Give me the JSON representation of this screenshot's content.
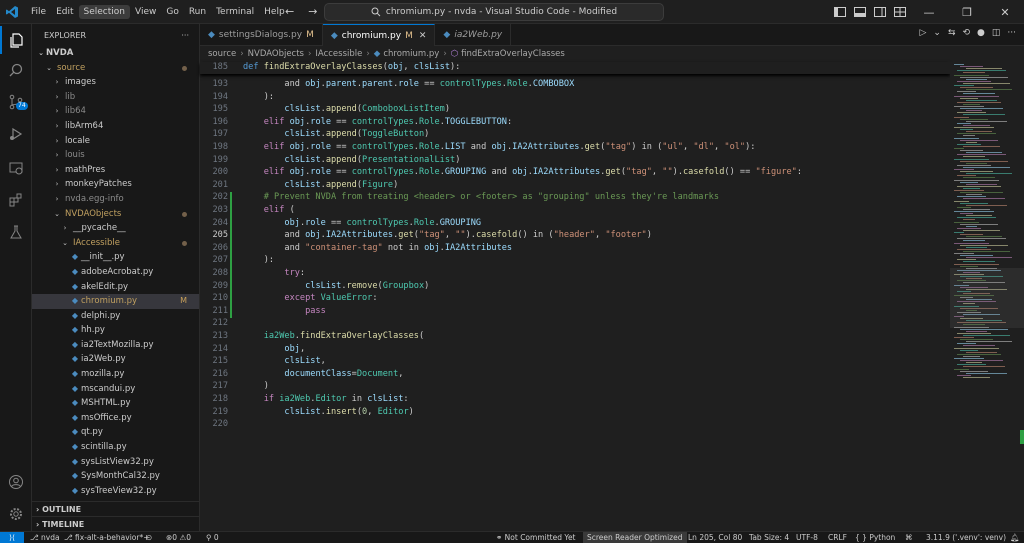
{
  "titlebar": {
    "menus": [
      "File",
      "Edit",
      "Selection",
      "View",
      "Go",
      "Run",
      "Terminal",
      "Help"
    ],
    "active_menu": "Selection",
    "command_center": "chromium.py - nvda - Visual Studio Code - Modified"
  },
  "activity": {
    "source_control_badge": "74"
  },
  "sidebar": {
    "title": "EXPLORER",
    "root": "NVDA",
    "items": [
      {
        "label": "source",
        "indent": 1,
        "type": "folder-open",
        "style": "yellow",
        "dot": true
      },
      {
        "label": "images",
        "indent": 2,
        "type": "folder"
      },
      {
        "label": "lib",
        "indent": 2,
        "type": "folder",
        "style": "dim"
      },
      {
        "label": "lib64",
        "indent": 2,
        "type": "folder",
        "style": "dim"
      },
      {
        "label": "libArm64",
        "indent": 2,
        "type": "folder"
      },
      {
        "label": "locale",
        "indent": 2,
        "type": "folder"
      },
      {
        "label": "louis",
        "indent": 2,
        "type": "folder",
        "style": "dim"
      },
      {
        "label": "mathPres",
        "indent": 2,
        "type": "folder"
      },
      {
        "label": "monkeyPatches",
        "indent": 2,
        "type": "folder"
      },
      {
        "label": "nvda.egg-info",
        "indent": 2,
        "type": "folder",
        "style": "dim"
      },
      {
        "label": "NVDAObjects",
        "indent": 2,
        "type": "folder-open",
        "style": "yellow",
        "dot": true
      },
      {
        "label": "__pycache__",
        "indent": 3,
        "type": "folder"
      },
      {
        "label": "IAccessible",
        "indent": 3,
        "type": "folder-open",
        "style": "yellow",
        "dot": true
      },
      {
        "label": "__init__.py",
        "indent": 4,
        "type": "py"
      },
      {
        "label": "adobeAcrobat.py",
        "indent": 4,
        "type": "py"
      },
      {
        "label": "akelEdit.py",
        "indent": 4,
        "type": "py"
      },
      {
        "label": "chromium.py",
        "indent": 4,
        "type": "py",
        "selected": true,
        "mark": "M",
        "style": "yellow"
      },
      {
        "label": "delphi.py",
        "indent": 4,
        "type": "py"
      },
      {
        "label": "hh.py",
        "indent": 4,
        "type": "py"
      },
      {
        "label": "ia2TextMozilla.py",
        "indent": 4,
        "type": "py"
      },
      {
        "label": "ia2Web.py",
        "indent": 4,
        "type": "py"
      },
      {
        "label": "mozilla.py",
        "indent": 4,
        "type": "py"
      },
      {
        "label": "mscandui.py",
        "indent": 4,
        "type": "py"
      },
      {
        "label": "MSHTML.py",
        "indent": 4,
        "type": "py"
      },
      {
        "label": "msOffice.py",
        "indent": 4,
        "type": "py"
      },
      {
        "label": "qt.py",
        "indent": 4,
        "type": "py"
      },
      {
        "label": "scintilla.py",
        "indent": 4,
        "type": "py"
      },
      {
        "label": "sysListView32.py",
        "indent": 4,
        "type": "py"
      },
      {
        "label": "SysMonthCal32.py",
        "indent": 4,
        "type": "py"
      },
      {
        "label": "sysTreeView32.py",
        "indent": 4,
        "type": "py"
      }
    ],
    "outline": "OUTLINE",
    "timeline": "TIMELINE"
  },
  "tabs": [
    {
      "label": "settingsDialogs.py",
      "mod": "M",
      "active": false,
      "italic": false
    },
    {
      "label": "chromium.py",
      "mod": "M",
      "active": true,
      "italic": false
    },
    {
      "label": "ia2Web.py",
      "mod": "",
      "active": false,
      "italic": true
    }
  ],
  "breadcrumb": [
    "source",
    "NVDAObjects",
    "IAccessible",
    "chromium.py",
    "findExtraOverlayClasses"
  ],
  "code": {
    "sticky": {
      "num": "185",
      "tokens": [
        [
          "kwb",
          "def "
        ],
        [
          "fn",
          "findExtraOverlayClasses"
        ],
        [
          "plain",
          "("
        ],
        [
          "var",
          "obj"
        ],
        [
          "plain",
          ", "
        ],
        [
          "var",
          "clsList"
        ],
        [
          "plain",
          "):"
        ]
      ]
    },
    "lines": [
      {
        "num": "193",
        "tokens": [
          [
            "plain",
            "        and "
          ],
          [
            "var",
            "obj"
          ],
          [
            "plain",
            "."
          ],
          [
            "var",
            "parent"
          ],
          [
            "plain",
            "."
          ],
          [
            "var",
            "parent"
          ],
          [
            "plain",
            "."
          ],
          [
            "var",
            "role"
          ],
          [
            "plain",
            " == "
          ],
          [
            "cls",
            "controlTypes"
          ],
          [
            "plain",
            "."
          ],
          [
            "cls",
            "Role"
          ],
          [
            "plain",
            "."
          ],
          [
            "var",
            "COMBOBOX"
          ]
        ]
      },
      {
        "num": "194",
        "tokens": [
          [
            "plain",
            "    ):"
          ]
        ]
      },
      {
        "num": "195",
        "tokens": [
          [
            "plain",
            "        "
          ],
          [
            "var",
            "clsList"
          ],
          [
            "plain",
            "."
          ],
          [
            "fn",
            "append"
          ],
          [
            "plain",
            "("
          ],
          [
            "cls",
            "ComboboxListItem"
          ],
          [
            "plain",
            ")"
          ]
        ]
      },
      {
        "num": "196",
        "tokens": [
          [
            "kw",
            "    elif "
          ],
          [
            "var",
            "obj"
          ],
          [
            "plain",
            "."
          ],
          [
            "var",
            "role"
          ],
          [
            "plain",
            " == "
          ],
          [
            "cls",
            "controlTypes"
          ],
          [
            "plain",
            "."
          ],
          [
            "cls",
            "Role"
          ],
          [
            "plain",
            "."
          ],
          [
            "var",
            "TOGGLEBUTTON"
          ],
          [
            "plain",
            ":"
          ]
        ]
      },
      {
        "num": "197",
        "tokens": [
          [
            "plain",
            "        "
          ],
          [
            "var",
            "clsList"
          ],
          [
            "plain",
            "."
          ],
          [
            "fn",
            "append"
          ],
          [
            "plain",
            "("
          ],
          [
            "cls",
            "ToggleButton"
          ],
          [
            "plain",
            ")"
          ]
        ]
      },
      {
        "num": "198",
        "tokens": [
          [
            "kw",
            "    elif "
          ],
          [
            "var",
            "obj"
          ],
          [
            "plain",
            "."
          ],
          [
            "var",
            "role"
          ],
          [
            "plain",
            " == "
          ],
          [
            "cls",
            "controlTypes"
          ],
          [
            "plain",
            "."
          ],
          [
            "cls",
            "Role"
          ],
          [
            "plain",
            "."
          ],
          [
            "var",
            "LIST"
          ],
          [
            "plain",
            " and "
          ],
          [
            "var",
            "obj"
          ],
          [
            "plain",
            "."
          ],
          [
            "var",
            "IA2Attributes"
          ],
          [
            "plain",
            "."
          ],
          [
            "fn",
            "get"
          ],
          [
            "plain",
            "("
          ],
          [
            "str",
            "\"tag\""
          ],
          [
            "plain",
            ") in ("
          ],
          [
            "str",
            "\"ul\""
          ],
          [
            "plain",
            ", "
          ],
          [
            "str",
            "\"dl\""
          ],
          [
            "plain",
            ", "
          ],
          [
            "str",
            "\"ol\""
          ],
          [
            "plain",
            "):"
          ]
        ]
      },
      {
        "num": "199",
        "tokens": [
          [
            "plain",
            "        "
          ],
          [
            "var",
            "clsList"
          ],
          [
            "plain",
            "."
          ],
          [
            "fn",
            "append"
          ],
          [
            "plain",
            "("
          ],
          [
            "cls",
            "PresentationalList"
          ],
          [
            "plain",
            ")"
          ]
        ]
      },
      {
        "num": "200",
        "tokens": [
          [
            "kw",
            "    elif "
          ],
          [
            "var",
            "obj"
          ],
          [
            "plain",
            "."
          ],
          [
            "var",
            "role"
          ],
          [
            "plain",
            " == "
          ],
          [
            "cls",
            "controlTypes"
          ],
          [
            "plain",
            "."
          ],
          [
            "cls",
            "Role"
          ],
          [
            "plain",
            "."
          ],
          [
            "var",
            "GROUPING"
          ],
          [
            "plain",
            " and "
          ],
          [
            "var",
            "obj"
          ],
          [
            "plain",
            "."
          ],
          [
            "var",
            "IA2Attributes"
          ],
          [
            "plain",
            "."
          ],
          [
            "fn",
            "get"
          ],
          [
            "plain",
            "("
          ],
          [
            "str",
            "\"tag\""
          ],
          [
            "plain",
            ", "
          ],
          [
            "str",
            "\"\""
          ],
          [
            "plain",
            ")."
          ],
          [
            "fn",
            "casefold"
          ],
          [
            "plain",
            "() == "
          ],
          [
            "str",
            "\"figure\""
          ],
          [
            "plain",
            ":"
          ]
        ]
      },
      {
        "num": "201",
        "tokens": [
          [
            "plain",
            "        "
          ],
          [
            "var",
            "clsList"
          ],
          [
            "plain",
            "."
          ],
          [
            "fn",
            "append"
          ],
          [
            "plain",
            "("
          ],
          [
            "cls",
            "Figure"
          ],
          [
            "plain",
            ")"
          ]
        ]
      },
      {
        "num": "202",
        "tokens": [
          [
            "cm",
            "    # Prevent NVDA from treating <header> or <footer> as \"grouping\" unless they're landmarks"
          ]
        ]
      },
      {
        "num": "203",
        "tokens": [
          [
            "kw",
            "    elif "
          ],
          [
            "plain",
            "("
          ]
        ]
      },
      {
        "num": "204",
        "tokens": [
          [
            "plain",
            "        "
          ],
          [
            "var",
            "obj"
          ],
          [
            "plain",
            "."
          ],
          [
            "var",
            "role"
          ],
          [
            "plain",
            " == "
          ],
          [
            "cls",
            "controlTypes"
          ],
          [
            "plain",
            "."
          ],
          [
            "cls",
            "Role"
          ],
          [
            "plain",
            "."
          ],
          [
            "var",
            "GROUPING"
          ]
        ]
      },
      {
        "num": "205",
        "tokens": [
          [
            "plain",
            "        and "
          ],
          [
            "var",
            "obj"
          ],
          [
            "plain",
            "."
          ],
          [
            "var",
            "IA2Attributes"
          ],
          [
            "plain",
            "."
          ],
          [
            "fn",
            "get"
          ],
          [
            "plain",
            "("
          ],
          [
            "str",
            "\"tag\""
          ],
          [
            "plain",
            ", "
          ],
          [
            "str",
            "\"\""
          ],
          [
            "plain",
            ")."
          ],
          [
            "fn",
            "casefold"
          ],
          [
            "plain",
            "() in ("
          ],
          [
            "str",
            "\"header\""
          ],
          [
            "plain",
            ", "
          ],
          [
            "str",
            "\"footer\""
          ],
          [
            "plain",
            ")"
          ]
        ]
      },
      {
        "num": "206",
        "tokens": [
          [
            "plain",
            "        and "
          ],
          [
            "str",
            "\"container-tag\""
          ],
          [
            "plain",
            " not in "
          ],
          [
            "var",
            "obj"
          ],
          [
            "plain",
            "."
          ],
          [
            "var",
            "IA2Attributes"
          ]
        ]
      },
      {
        "num": "207",
        "tokens": [
          [
            "plain",
            "    ):"
          ]
        ]
      },
      {
        "num": "208",
        "tokens": [
          [
            "kw",
            "        try"
          ],
          [
            "plain",
            ":"
          ]
        ]
      },
      {
        "num": "209",
        "tokens": [
          [
            "plain",
            "            "
          ],
          [
            "var",
            "clsList"
          ],
          [
            "plain",
            "."
          ],
          [
            "fn",
            "remove"
          ],
          [
            "plain",
            "("
          ],
          [
            "cls",
            "Groupbox"
          ],
          [
            "plain",
            ")"
          ]
        ]
      },
      {
        "num": "210",
        "tokens": [
          [
            "kw",
            "        except "
          ],
          [
            "cls",
            "ValueError"
          ],
          [
            "plain",
            ":"
          ]
        ]
      },
      {
        "num": "211",
        "tokens": [
          [
            "kw",
            "            pass"
          ]
        ]
      },
      {
        "num": "212",
        "tokens": []
      },
      {
        "num": "213",
        "tokens": [
          [
            "plain",
            "    "
          ],
          [
            "cls",
            "ia2Web"
          ],
          [
            "plain",
            "."
          ],
          [
            "fn",
            "findExtraOverlayClasses"
          ],
          [
            "plain",
            "("
          ]
        ]
      },
      {
        "num": "214",
        "tokens": [
          [
            "plain",
            "        "
          ],
          [
            "var",
            "obj"
          ],
          [
            "plain",
            ","
          ]
        ]
      },
      {
        "num": "215",
        "tokens": [
          [
            "plain",
            "        "
          ],
          [
            "var",
            "clsList"
          ],
          [
            "plain",
            ","
          ]
        ]
      },
      {
        "num": "216",
        "tokens": [
          [
            "plain",
            "        "
          ],
          [
            "var",
            "documentClass"
          ],
          [
            "plain",
            "="
          ],
          [
            "cls",
            "Document"
          ],
          [
            "plain",
            ","
          ]
        ]
      },
      {
        "num": "217",
        "tokens": [
          [
            "plain",
            "    )"
          ]
        ]
      },
      {
        "num": "218",
        "tokens": [
          [
            "kw",
            "    if "
          ],
          [
            "cls",
            "ia2Web"
          ],
          [
            "plain",
            "."
          ],
          [
            "cls",
            "Editor"
          ],
          [
            "plain",
            " in "
          ],
          [
            "var",
            "clsList"
          ],
          [
            "plain",
            ":"
          ]
        ]
      },
      {
        "num": "219",
        "tokens": [
          [
            "plain",
            "        "
          ],
          [
            "var",
            "clsList"
          ],
          [
            "plain",
            "."
          ],
          [
            "fn",
            "insert"
          ],
          [
            "plain",
            "("
          ],
          [
            "num",
            "0"
          ],
          [
            "plain",
            ", "
          ],
          [
            "cls",
            "Editor"
          ],
          [
            "plain",
            ")"
          ]
        ]
      },
      {
        "num": "220",
        "tokens": []
      }
    ]
  },
  "status": {
    "branch_repo": "nvda",
    "branch": "fix-alt-a-behavior*+",
    "errors": "0",
    "warnings": "0",
    "ports": "0",
    "commit": "Not Committed Yet",
    "screen_reader": "Screen Reader Optimized",
    "position": "Ln 205, Col 80",
    "tab_size": "Tab Size: 4",
    "encoding": "UTF-8",
    "eol": "CRLF",
    "language": "Python",
    "python_version": "3.11.9 ('.venv': venv)"
  },
  "colors": {
    "accent": "#0078d4",
    "keyword": "#c586c0",
    "function": "#dcdcaa",
    "class": "#4ec9b0",
    "string": "#ce9178",
    "comment": "#6a9955",
    "variable": "#9cdcfe"
  }
}
